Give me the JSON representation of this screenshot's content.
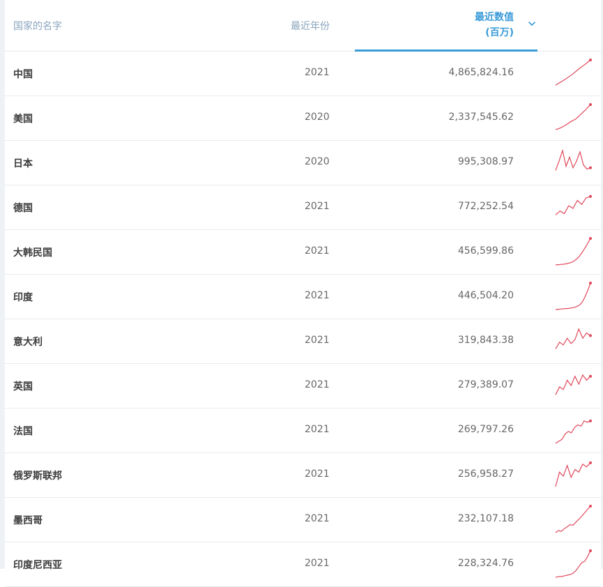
{
  "header": {
    "name_label": "国家的名字",
    "year_label": "最近年份",
    "value_label_line1": "最近数值",
    "value_label_line2": "(百万)",
    "sort_icon": "chevron-down-icon"
  },
  "colors": {
    "accent": "#3a9bd8",
    "spark": "#e0475a"
  },
  "rows": [
    {
      "country": "中国",
      "year": "2021",
      "value": "4,865,824.16",
      "spark": [
        0.05,
        0.18,
        0.32,
        0.48,
        0.66,
        0.82,
        1.0
      ]
    },
    {
      "country": "美国",
      "year": "2020",
      "value": "2,337,545.62",
      "spark": [
        0.05,
        0.12,
        0.22,
        0.35,
        0.45,
        0.62,
        0.8,
        1.0
      ]
    },
    {
      "country": "日本",
      "year": "2020",
      "value": "995,308.97",
      "spark": [
        0.2,
        0.55,
        0.95,
        0.35,
        0.7,
        0.3,
        0.55,
        0.9,
        0.4,
        0.25,
        0.3
      ]
    },
    {
      "country": "德国",
      "year": "2021",
      "value": "772,252.54",
      "spark": [
        0.2,
        0.35,
        0.25,
        0.55,
        0.45,
        0.75,
        0.6,
        0.85,
        0.9
      ]
    },
    {
      "country": "大韩民国",
      "year": "2021",
      "value": "456,599.86",
      "spark": [
        0.0,
        0.01,
        0.02,
        0.03,
        0.05,
        0.08,
        0.12,
        0.2,
        0.3,
        0.45,
        0.62,
        0.8,
        1.0
      ]
    },
    {
      "country": "印度",
      "year": "2021",
      "value": "446,504.20",
      "spark": [
        0.0,
        0.01,
        0.02,
        0.03,
        0.04,
        0.05,
        0.07,
        0.1,
        0.15,
        0.25,
        0.45,
        0.7,
        1.0
      ]
    },
    {
      "country": "意大利",
      "year": "2021",
      "value": "319,843.38",
      "spark": [
        0.2,
        0.45,
        0.35,
        0.6,
        0.4,
        0.55,
        0.95,
        0.6,
        0.8,
        0.7
      ]
    },
    {
      "country": "英国",
      "year": "2021",
      "value": "279,389.07",
      "spark": [
        0.15,
        0.45,
        0.35,
        0.7,
        0.5,
        0.85,
        0.55,
        0.9,
        0.7,
        0.85
      ]
    },
    {
      "country": "法国",
      "year": "2021",
      "value": "269,797.26",
      "spark": [
        0.0,
        0.08,
        0.15,
        0.35,
        0.45,
        0.4,
        0.6,
        0.7,
        0.65,
        0.85,
        0.8,
        0.85
      ]
    },
    {
      "country": "俄罗斯联邦",
      "year": "2021",
      "value": "256,958.27",
      "spark": [
        0.05,
        0.6,
        0.45,
        0.85,
        0.4,
        0.7,
        0.6,
        0.9,
        0.8,
        0.95
      ]
    },
    {
      "country": "墨西哥",
      "year": "2021",
      "value": "232,107.18",
      "spark": [
        0.0,
        0.08,
        0.05,
        0.15,
        0.22,
        0.3,
        0.28,
        0.4,
        0.5,
        0.62,
        0.75,
        0.88,
        1.0
      ]
    },
    {
      "country": "印度尼西亚",
      "year": "2021",
      "value": "228,324.76",
      "spark": [
        0.0,
        0.02,
        0.03,
        0.05,
        0.08,
        0.1,
        0.15,
        0.25,
        0.4,
        0.55,
        0.6,
        0.78,
        1.0
      ]
    }
  ]
}
